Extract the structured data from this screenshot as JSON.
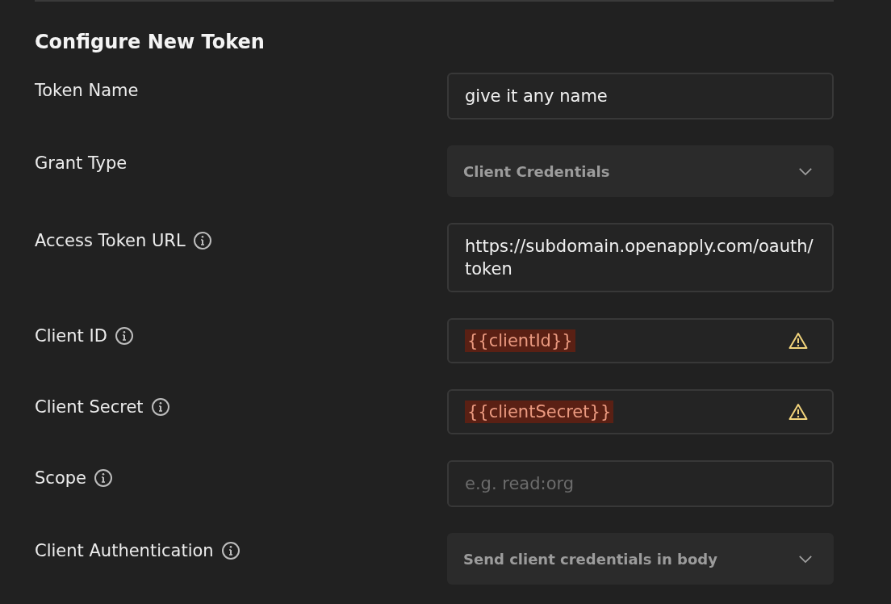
{
  "heading": "Configure New Token",
  "fields": [
    {
      "label": "Token Name",
      "info": false,
      "kind": "text",
      "value": "give it any name"
    },
    {
      "label": "Grant Type",
      "info": false,
      "kind": "select",
      "value": "Client Credentials"
    },
    {
      "label": "Access Token URL",
      "info": true,
      "kind": "text",
      "value": "https://subdomain.openapply.com/oauth/token"
    },
    {
      "label": "Client ID",
      "info": true,
      "kind": "variable",
      "value": "{{clientId}}",
      "warning": true
    },
    {
      "label": "Client Secret",
      "info": true,
      "kind": "variable",
      "value": "{{clientSecret}}",
      "warning": true
    },
    {
      "label": "Scope",
      "info": true,
      "kind": "text",
      "placeholder": "e.g. read:org"
    },
    {
      "label": "Client Authentication",
      "info": true,
      "kind": "select",
      "value": "Send client credentials in body"
    }
  ]
}
